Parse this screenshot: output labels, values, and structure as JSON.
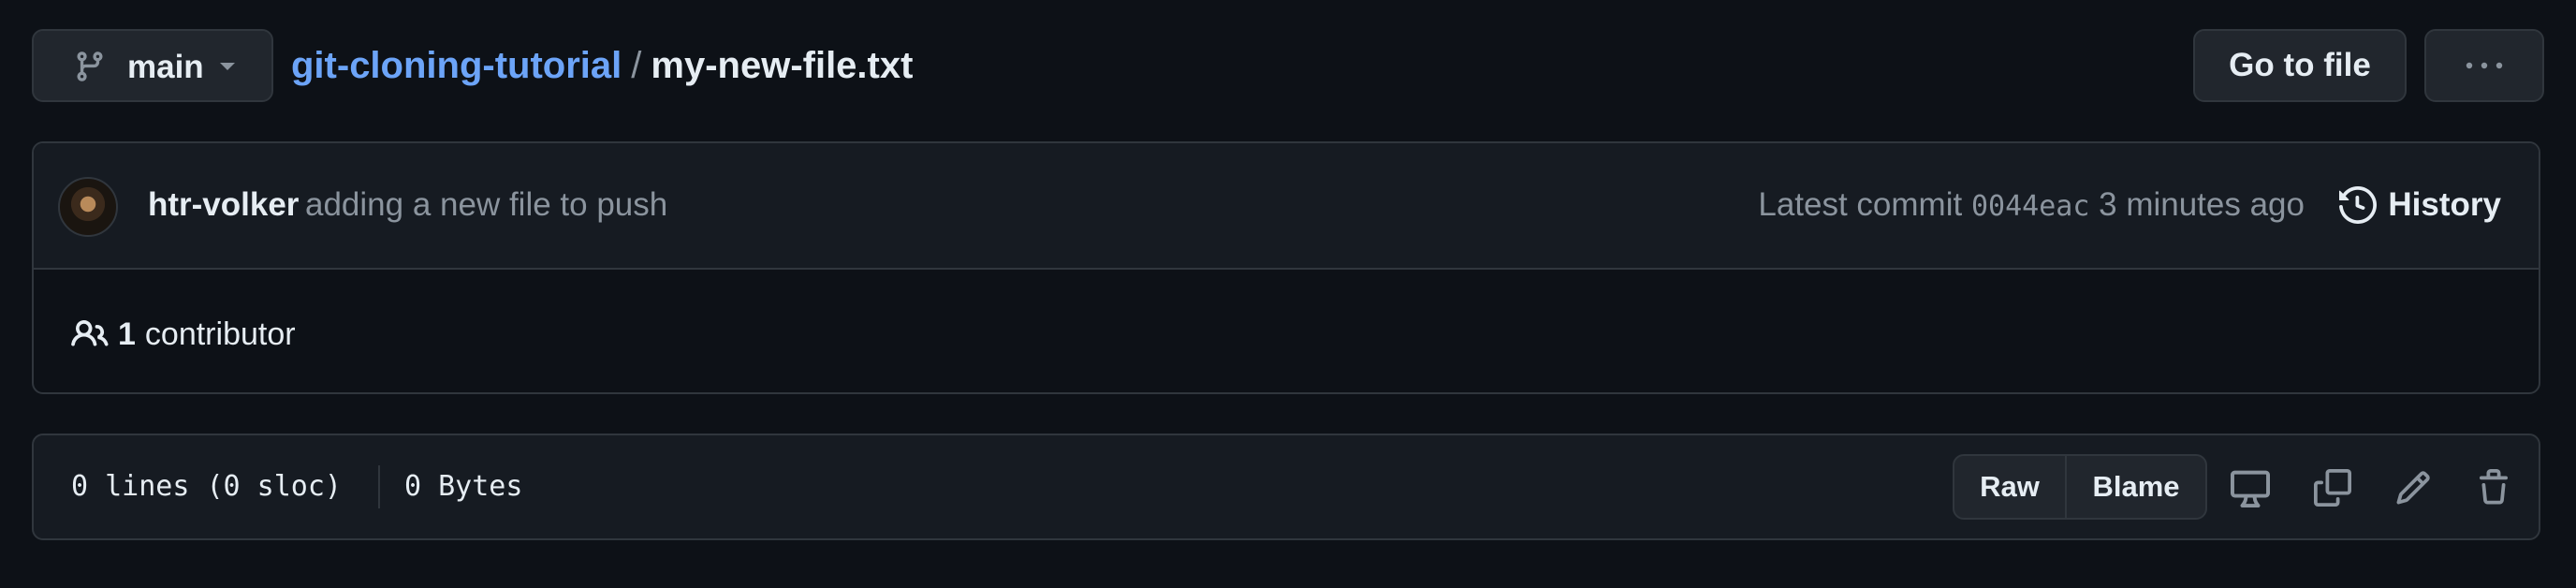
{
  "branch": {
    "name": "main",
    "icon": "git-branch-icon",
    "dropdown_icon": "caret-down-icon"
  },
  "breadcrumb": {
    "repo": "git-cloning-tutorial",
    "separator": "/",
    "file": "my-new-file.txt"
  },
  "header_actions": {
    "goto_file_label": "Go to file",
    "more_icon": "kebab-horizontal-icon"
  },
  "commit": {
    "author": "htr-volker",
    "message": "adding a new file to push",
    "latest_label": "Latest commit",
    "sha": "0044eac",
    "time_ago": "3 minutes ago",
    "history_label": "History"
  },
  "contributors": {
    "count": "1",
    "label": "contributor"
  },
  "file_info": {
    "lines": "0 lines (0 sloc)",
    "size": "0 Bytes"
  },
  "file_actions": {
    "raw_label": "Raw",
    "blame_label": "Blame",
    "icons": [
      "desktop-icon",
      "copy-icon",
      "pencil-icon",
      "trash-icon"
    ]
  },
  "colors": {
    "background": "#0d1117",
    "panel": "#161b22",
    "border": "#30363d",
    "link": "#6ca4f8",
    "muted": "#8b949e",
    "text": "#e6edf3"
  }
}
